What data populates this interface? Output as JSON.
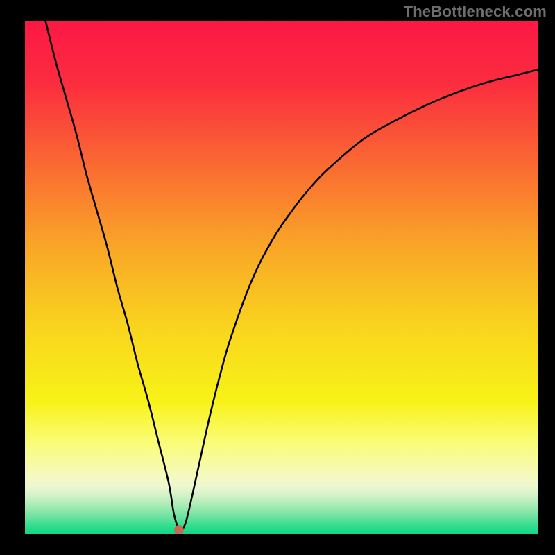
{
  "watermark": "TheBottleneck.com",
  "chart_data": {
    "type": "line",
    "title": "",
    "xlabel": "",
    "ylabel": "",
    "xlim": [
      0,
      100
    ],
    "ylim": [
      0,
      100
    ],
    "grid": false,
    "series": [
      {
        "name": "curve",
        "x": [
          4,
          6,
          8,
          10,
          12,
          14,
          16,
          18,
          20,
          22,
          24,
          26,
          28,
          29,
          30,
          31,
          32,
          34,
          36,
          38,
          40,
          44,
          48,
          52,
          56,
          60,
          66,
          72,
          78,
          84,
          90,
          96,
          100
        ],
        "y": [
          100,
          92,
          85,
          78,
          70,
          63,
          56,
          48,
          41,
          33,
          26,
          18,
          10,
          4,
          1,
          1.5,
          5,
          14,
          23,
          31,
          38,
          49,
          57,
          63,
          68,
          72,
          77,
          80.5,
          83.5,
          86,
          88,
          89.5,
          90.5
        ]
      }
    ],
    "annotations": [
      {
        "name": "minimum-marker",
        "shape": "dot",
        "x": 30,
        "y": 0.8,
        "color": "#c66a58"
      }
    ],
    "background": {
      "type": "vertical-gradient",
      "stops": [
        {
          "pos": 0.0,
          "color": "#fc1845"
        },
        {
          "pos": 0.12,
          "color": "#fb2c3f"
        },
        {
          "pos": 0.28,
          "color": "#fa6a32"
        },
        {
          "pos": 0.44,
          "color": "#f9a627"
        },
        {
          "pos": 0.6,
          "color": "#f9d51e"
        },
        {
          "pos": 0.74,
          "color": "#f8f217"
        },
        {
          "pos": 0.82,
          "color": "#fafc75"
        },
        {
          "pos": 0.88,
          "color": "#f6fab8"
        },
        {
          "pos": 0.905,
          "color": "#eef8d0"
        },
        {
          "pos": 0.925,
          "color": "#d2f2c6"
        },
        {
          "pos": 0.945,
          "color": "#a6ebb5"
        },
        {
          "pos": 0.965,
          "color": "#6fe3a0"
        },
        {
          "pos": 0.985,
          "color": "#2fdc8d"
        },
        {
          "pos": 1.0,
          "color": "#0fd884"
        }
      ]
    }
  }
}
